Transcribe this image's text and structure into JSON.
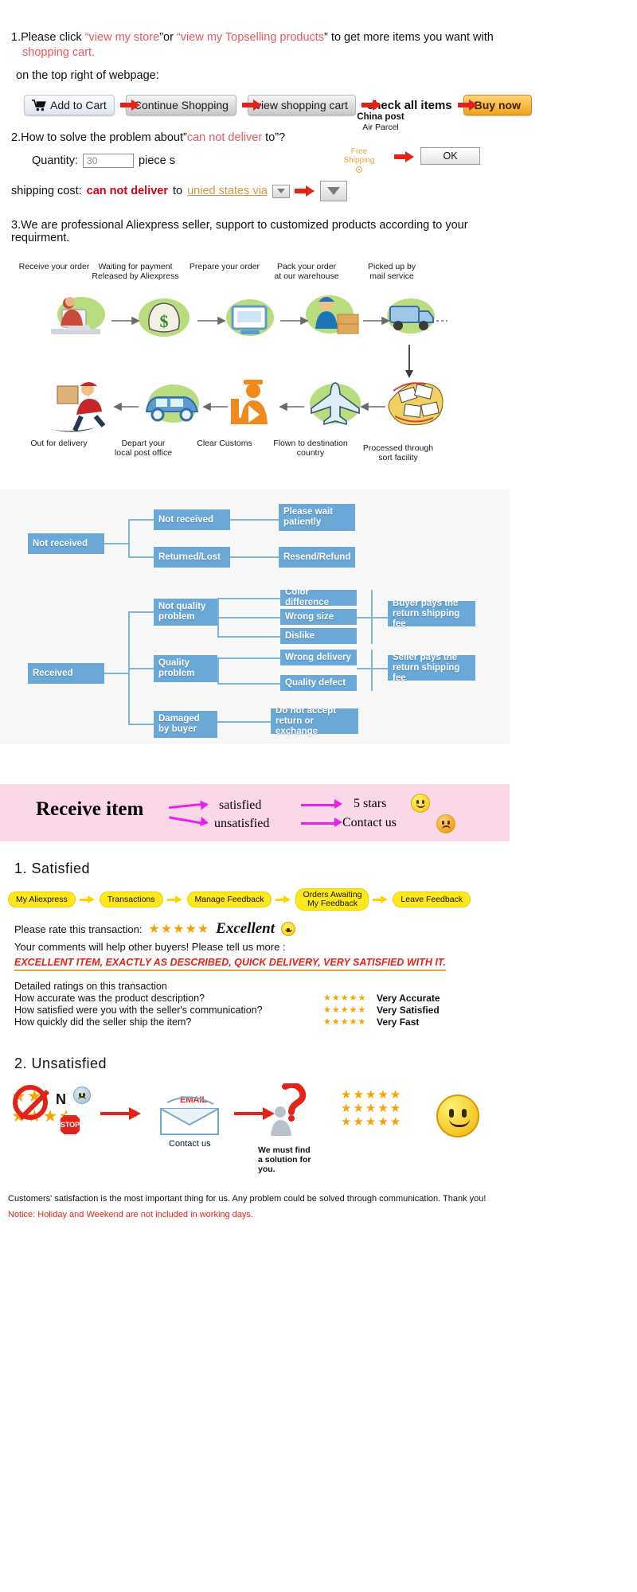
{
  "section1": {
    "intro_prefix": "1.Please click ",
    "link1": "view my store",
    "mid": "or ",
    "link2": "view my Topselling products",
    "intro_suffix": " to get more items you want with",
    "intro_line2": "shopping cart.",
    "intro_line3": "on the top right of webpage:",
    "buttons": [
      {
        "label": "Add to Cart",
        "style": "light",
        "icon": "shopping-cart-icon"
      },
      {
        "label": "Continue Shopping",
        "style": "grey",
        "icon": ""
      },
      {
        "label": "view shopping cart",
        "style": "grey",
        "icon": ""
      },
      {
        "label": "check all items",
        "style": "plain",
        "icon": ""
      },
      {
        "label": "Buy now",
        "style": "buy",
        "icon": ""
      }
    ]
  },
  "section2": {
    "heading_prefix": "2.How to solve the problem about”",
    "heading_red": "can not deliver",
    "heading_suffix": " to”?",
    "quantity_label": "Quantity:",
    "quantity_value": "30",
    "quantity_unit": "piece s",
    "shipping_label": "shipping cost:",
    "shipping_red": "can not deliver",
    "shipping_to": " to ",
    "shipping_country": "unied states via",
    "carrier_title": "China post",
    "carrier_sub": "Air Parcel",
    "free_shipping": "Free\nShipping",
    "ok_label": "OK"
  },
  "section3": {
    "text": "3.We are professional Aliexpress seller, support to customized products according to your requirment."
  },
  "shipping_flow": {
    "row1": [
      {
        "label": "Receive your order",
        "icon": "person-at-computer-icon"
      },
      {
        "label": "Waiting for payment\nReleased by Aliexpress",
        "icon": "money-bag-icon"
      },
      {
        "label": "Prepare your order",
        "icon": "computer-box-icon"
      },
      {
        "label": "Pack your order\nat our warehouse",
        "icon": "worker-packing-icon"
      },
      {
        "label": "Picked up by\nmail service",
        "icon": "mail-truck-icon"
      }
    ],
    "row2": [
      {
        "label": "Out for delivery",
        "icon": "delivery-man-running-icon"
      },
      {
        "label": "Depart your\nlocal post office",
        "icon": "blue-van-icon"
      },
      {
        "label": "Clear Customs",
        "icon": "customs-officer-icon"
      },
      {
        "label": "Flown to destination\ncountry",
        "icon": "airplane-icon"
      },
      {
        "label": "Processed through\nsort facility",
        "icon": "mail-sorting-icon"
      }
    ]
  },
  "decision_tree": {
    "not_received": {
      "root": "Not received",
      "branches": [
        {
          "mid": "Not received",
          "end": "Please wait\npatiently"
        },
        {
          "mid": "Returned/Lost",
          "end": "Resend/Refund"
        }
      ]
    },
    "received": {
      "root": "Received",
      "branches": [
        {
          "mid": "Not quality\nproblem",
          "leaves": [
            "Color difference",
            "Wrong size",
            "Dislike"
          ],
          "end": "Buyer pays the\nreturn shipping fee"
        },
        {
          "mid": "Quality\nproblem",
          "leaves": [
            "Wrong delivery",
            "Quality defect"
          ],
          "end": "Seller pays the\nreturn shipping fee"
        },
        {
          "mid": "Damaged\nby buyer",
          "leaves": [],
          "end": "Do not accept\nreturn or exchange"
        }
      ]
    }
  },
  "banner": {
    "title": "Receive item",
    "path1_mid": "satisfied",
    "path1_end": "5 stars",
    "path2_mid": "unsatisfied",
    "path2_end": "Contact us",
    "smiley_happy": "happy-face-icon",
    "smiley_sad": "sad-face-icon"
  },
  "satisfied": {
    "heading": "1. Satisfied",
    "steps": [
      "My Aliexpress",
      "Transactions",
      "Manage Feedback",
      "Orders Awaiting\nMy Feedback",
      "Leave Feedback"
    ],
    "rate_label": "Please rate this transaction:",
    "rate_stars": "★★★★★",
    "rate_word": "Excellent",
    "comment_label": "Your comments will help other buyers! Please tell us more :",
    "comment_text": "EXCELLENT ITEM, EXACTLY AS DESCRIBED, QUICK DELIVERY, VERY SATISFIED WITH IT.",
    "detail_heading": "Detailed ratings on this transaction",
    "detail_rows": [
      {
        "question": "How accurate was the product description?",
        "stars": "★★★★★",
        "verdict": "Very Accurate"
      },
      {
        "question": "How satisfied were you with the seller's communication?",
        "stars": "★★★★★",
        "verdict": "Very Satisfied"
      },
      {
        "question": "How quickly did the seller ship the item?",
        "stars": "★★★★★",
        "verdict": "Very Fast"
      }
    ]
  },
  "unsatisfied": {
    "heading": "2. Unsatisfied",
    "no_label": "N",
    "stop_label": "STOP",
    "email_label": "EMAIL",
    "contact_label": "Contact us",
    "solution_label": "We must find\na solution for\nyou.",
    "stars_block": "★★★★★",
    "footnote1": "Customers' satisfaction is the most important thing for us. Any problem could be solved through communication. Thank you!",
    "footnote2": "Notice: Holiday and Weekend are not included in working days."
  },
  "colors": {
    "red": "#e2231a",
    "soft_red": "#e8595b",
    "blue_box": "#6aa8d8",
    "yellow_pill": "#ffe81a",
    "pink_banner": "#fbd8e8",
    "magenta": "#e820e8",
    "orange_star": "#f5a400",
    "green_blob": "#b9dd7e"
  }
}
